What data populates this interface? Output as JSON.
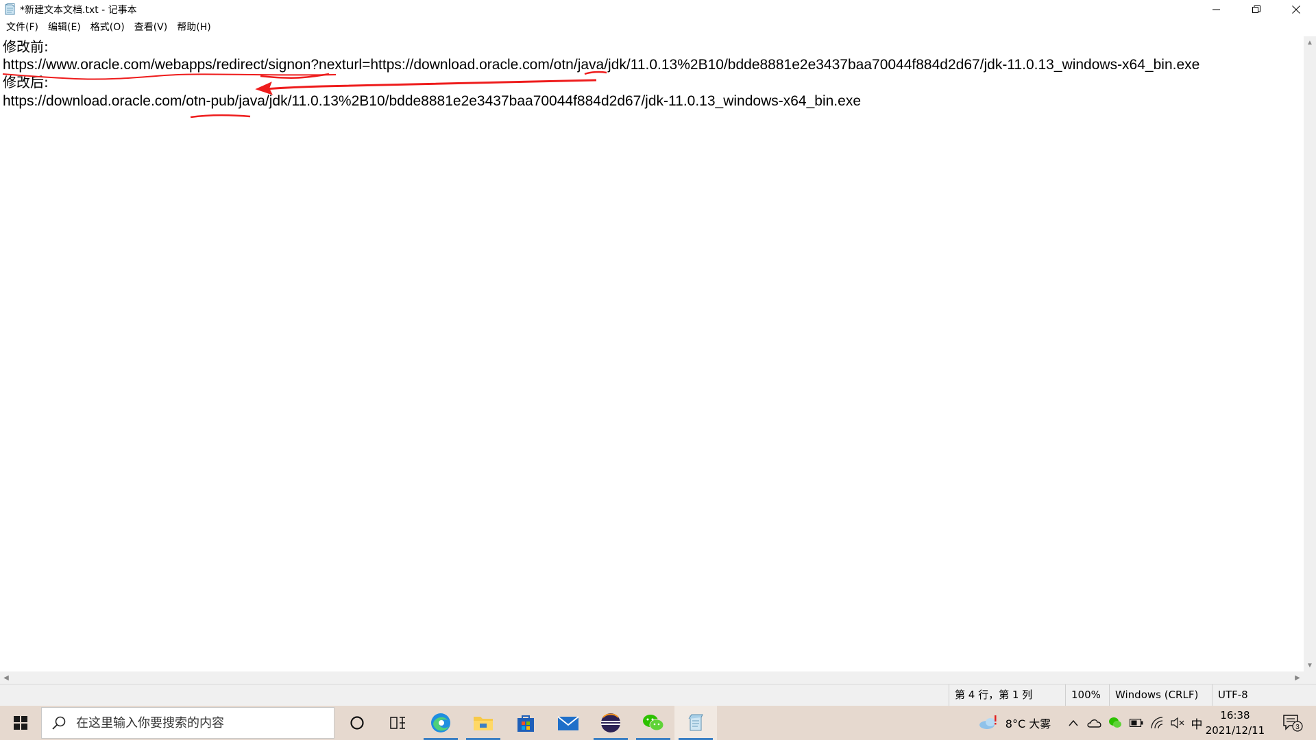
{
  "window": {
    "title": "*新建文本文档.txt - 记事本"
  },
  "menu": [
    "文件(F)",
    "编辑(E)",
    "格式(O)",
    "查看(V)",
    "帮助(H)"
  ],
  "editor": {
    "lines": [
      "修改前:",
      "https://www.oracle.com/webapps/redirect/signon?nexturl=https://download.oracle.com/otn/java/jdk/11.0.13%2B10/bdde8881e2e3437baa70044f884d2d67/jdk-11.0.13_windows-x64_bin.exe",
      "修改后:",
      "https://download.oracle.com/otn-pub/java/jdk/11.0.13%2B10/bdde8881e2e3437baa70044f884d2d67/jdk-11.0.13_windows-x64_bin.exe"
    ],
    "annotation_color": "#ee1c1c"
  },
  "status": {
    "position": "第 4 行，第 1 列",
    "zoom": "100%",
    "line_ending": "Windows (CRLF)",
    "encoding": "UTF-8"
  },
  "taskbar": {
    "search_placeholder": "在这里输入你要搜索的内容",
    "weather": "8°C 大雾",
    "ime": "中",
    "time": "16:38",
    "date": "2021/12/11",
    "notification_count": "3",
    "accent": "#3a7fc4"
  }
}
